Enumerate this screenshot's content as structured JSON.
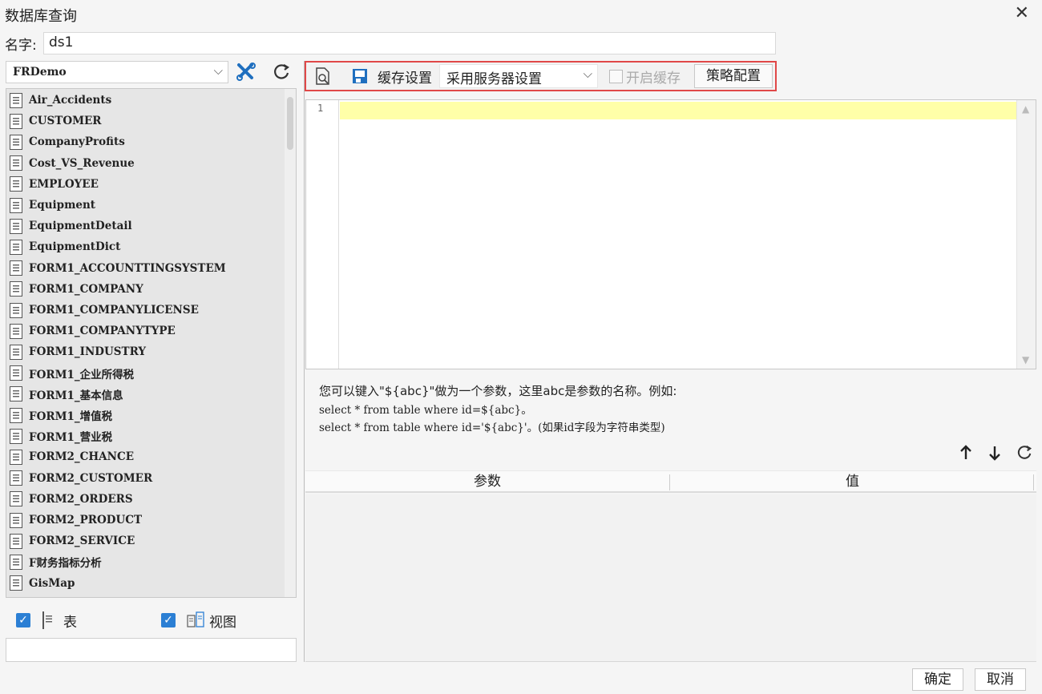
{
  "window": {
    "title": "数据库查询",
    "close_glyph": "✕"
  },
  "name_field": {
    "label": "名字:",
    "value": "ds1"
  },
  "datasource": {
    "selected": "FRDemo"
  },
  "tables": [
    "Air_Accidents",
    "CUSTOMER",
    "CompanyProfits",
    "Cost_VS_Revenue",
    "EMPLOYEE",
    "Equipment",
    "EquipmentDetail",
    "EquipmentDict",
    "FORM1_ACCOUNTTINGSYSTEM",
    "FORM1_COMPANY",
    "FORM1_COMPANYLICENSE",
    "FORM1_COMPANYTYPE",
    "FORM1_INDUSTRY",
    "FORM1_企业所得税",
    "FORM1_基本信息",
    "FORM1_增值税",
    "FORM1_营业税",
    "FORM2_CHANCE",
    "FORM2_CUSTOMER",
    "FORM2_ORDERS",
    "FORM2_PRODUCT",
    "FORM2_SERVICE",
    "F财务指标分析",
    "GisMap"
  ],
  "filters": {
    "table_label": "表",
    "table_checked": true,
    "view_label": "视图",
    "view_checked": true
  },
  "toolbar": {
    "cache_label": "缓存设置",
    "cache_select": "采用服务器设置",
    "enable_cache_label": "开启缓存",
    "strategy_button": "策略配置"
  },
  "editor": {
    "line_number": "1",
    "content": ""
  },
  "hint": {
    "line1": "您可以键入\"${abc}\"做为一个参数，这里abc是参数的名称。例如:",
    "line2": "select * from table where id=${abc}。",
    "line3": "select * from table where id='${abc}'。(如果id字段为字符串类型)"
  },
  "params": {
    "col_param": "参数",
    "col_value": "值",
    "rows": []
  },
  "footer": {
    "ok": "确定",
    "cancel": "取消"
  },
  "colors": {
    "highlight_border": "#e04848",
    "line_highlight": "#ffffa8",
    "checkbox": "#2b7fd4"
  }
}
